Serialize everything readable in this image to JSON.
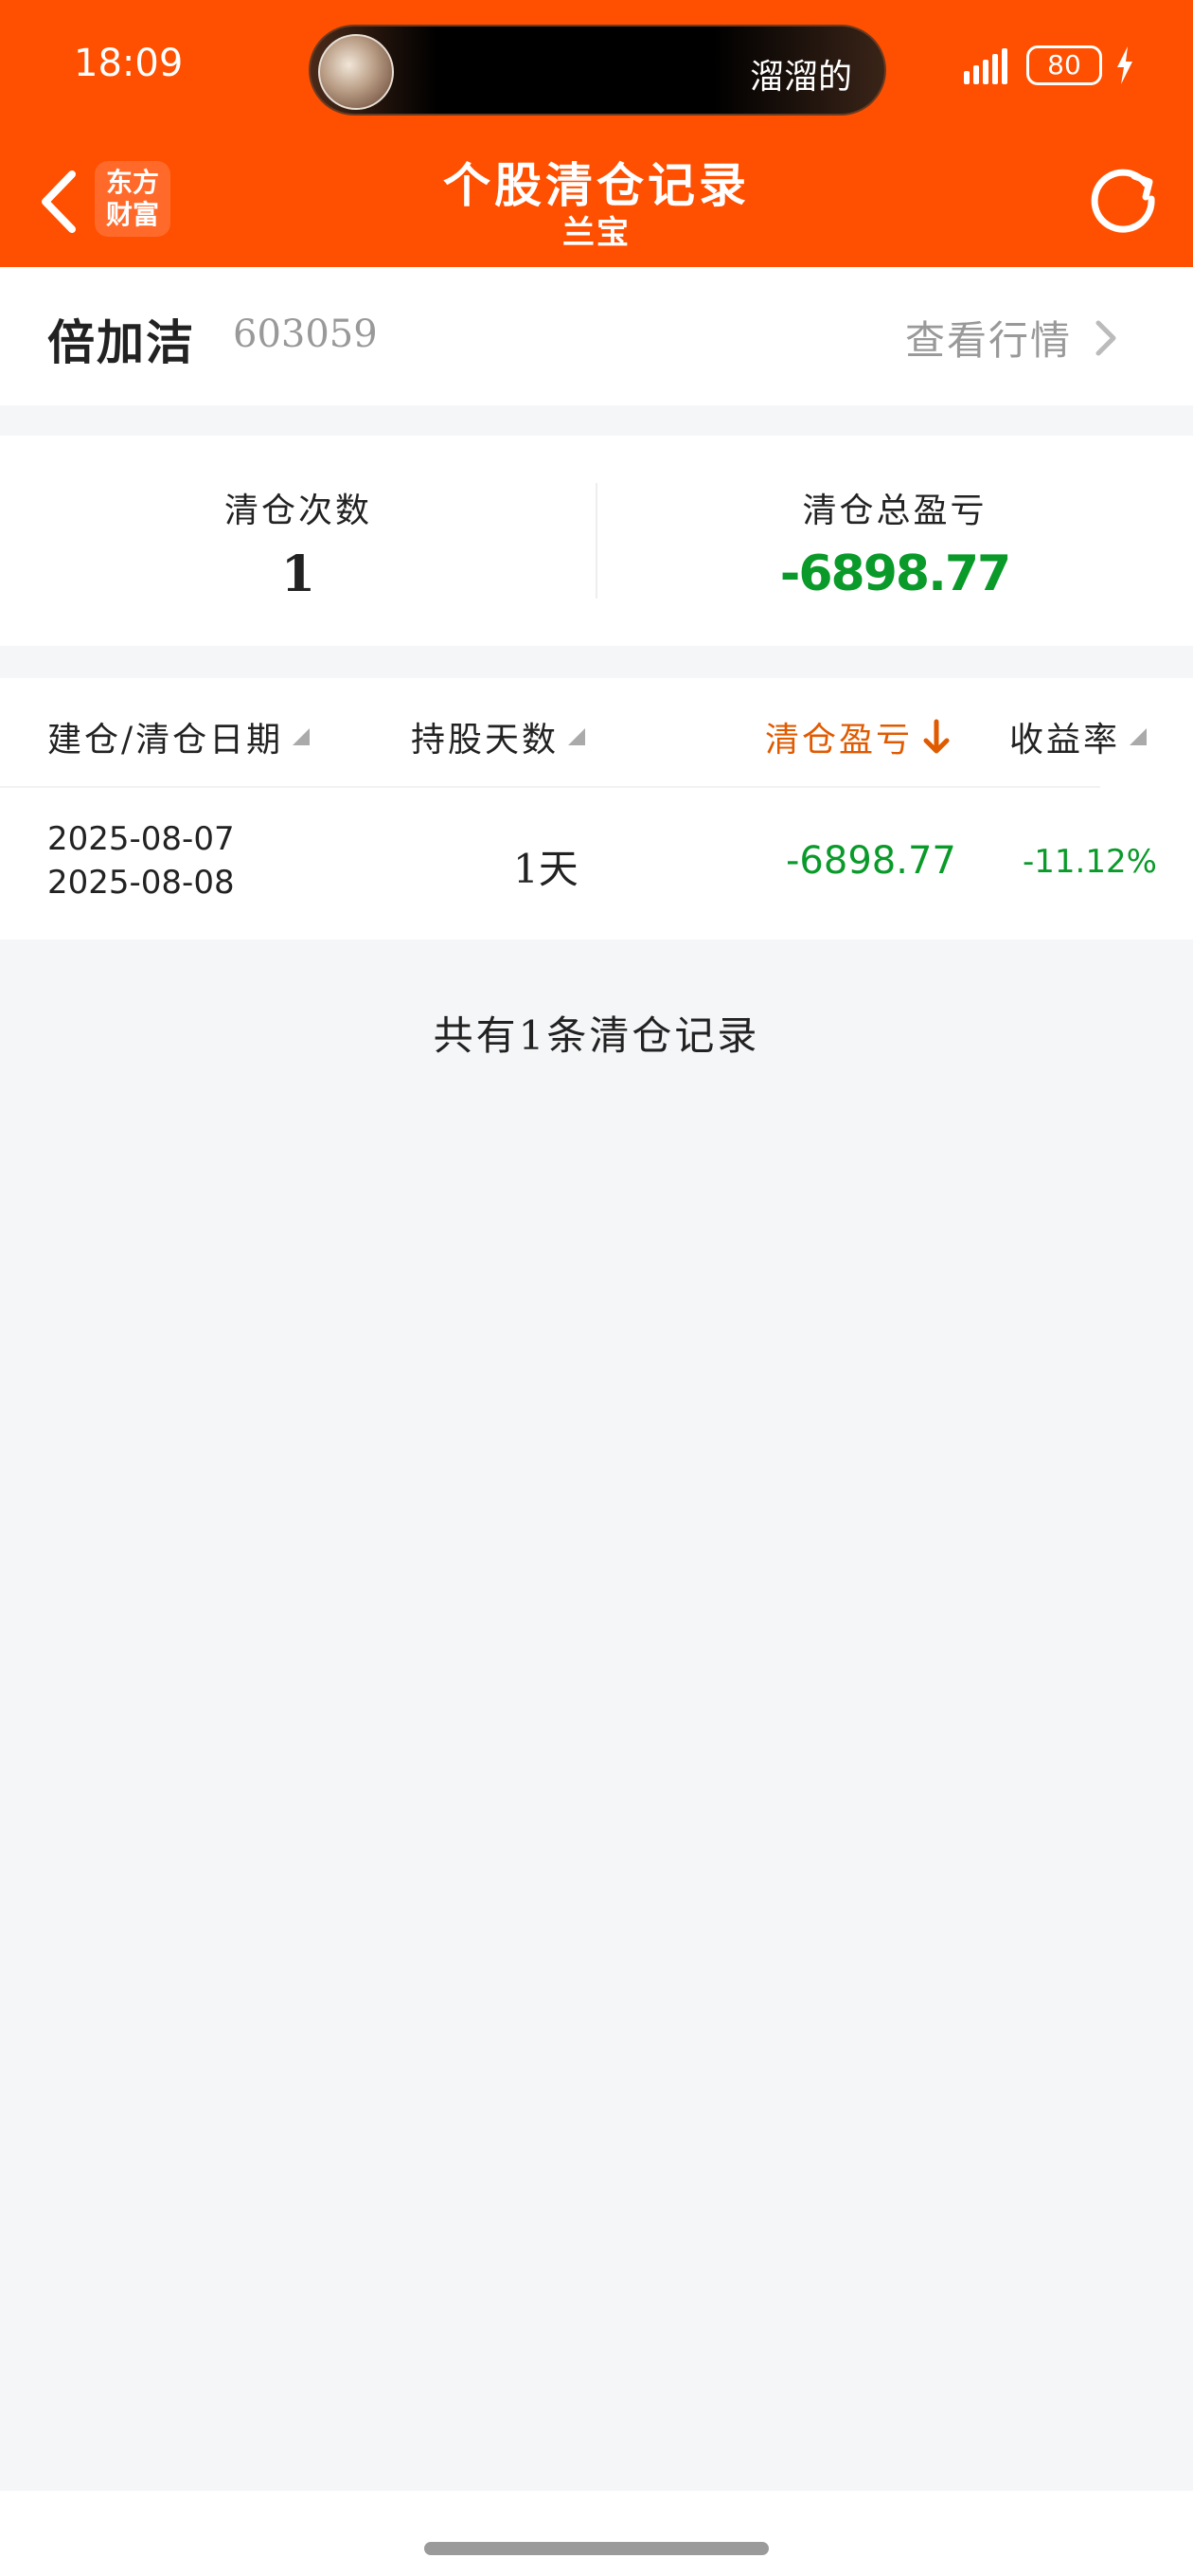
{
  "status_bar": {
    "time": "18:09",
    "island_text": "溜溜的",
    "battery": "80",
    "icons": [
      "signal-icon",
      "battery-icon",
      "charging-bolt-icon"
    ]
  },
  "nav": {
    "logo_line1": "东方",
    "logo_line2": "财富",
    "title": "个股清仓记录",
    "subtitle": "兰宝",
    "icons": [
      "back-arrow-icon",
      "refresh-icon"
    ]
  },
  "stock": {
    "name": "倍加洁",
    "code": "603059",
    "market_link": "查看行情"
  },
  "summary": {
    "count_label": "清仓次数",
    "count_value": "1",
    "pnl_label": "清仓总盈亏",
    "pnl_value": "-6898.77"
  },
  "table": {
    "headers": {
      "dates": "建仓/清仓日期",
      "days": "持股天数",
      "pnl": "清仓盈亏",
      "rate": "收益率"
    },
    "rows": [
      {
        "open_date": "2025-08-07",
        "close_date": "2025-08-08",
        "days": "1天",
        "pnl": "-6898.77",
        "rate": "-11.12%"
      }
    ]
  },
  "footer": {
    "record_count_text": "共有1条清仓记录"
  },
  "colors": {
    "brand": "#ff4f00",
    "loss_green": "#0a9a2a",
    "active_sort": "#e05a00",
    "background": "#f5f6f8"
  }
}
